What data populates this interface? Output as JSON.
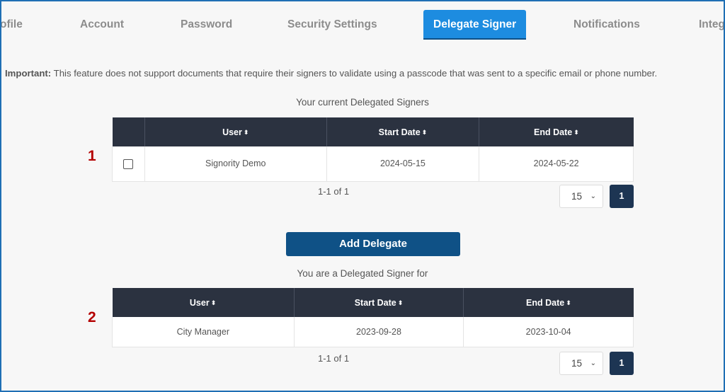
{
  "tabs": [
    {
      "label": "ofile"
    },
    {
      "label": "Account"
    },
    {
      "label": "Password"
    },
    {
      "label": "Security Settings"
    },
    {
      "label": "Delegate Signer"
    },
    {
      "label": "Notifications"
    },
    {
      "label": "Integ"
    }
  ],
  "notice": {
    "bold": "Important:",
    "text": "This feature does not support documents that require their signers to validate using a passcode that was sent to a specific email or phone number."
  },
  "current": {
    "caption": "Your current Delegated Signers",
    "marker": "1",
    "columns": [
      "User",
      "Start Date",
      "End Date"
    ],
    "rows": [
      {
        "user": "Signority Demo",
        "start": "2024-05-15",
        "end": "2024-05-22"
      }
    ],
    "range": "1-1 of 1",
    "page_size": "15",
    "page": "1"
  },
  "add_button": "Add Delegate",
  "delegated_for": {
    "caption": "You are a Delegated Signer for",
    "marker": "2",
    "columns": [
      "User",
      "Start Date",
      "End Date"
    ],
    "rows": [
      {
        "user": "City Manager",
        "start": "2023-09-28",
        "end": "2023-10-04"
      }
    ],
    "range": "1-1 of 1",
    "page_size": "15",
    "page": "1"
  },
  "icons": {
    "sort": "sort-icon",
    "dropdown": "chevron-down-icon"
  },
  "colors": {
    "active_tab": "#1d8ce0",
    "table_header": "#2b3240",
    "primary_button": "#0f5186",
    "page_button": "#1d3553",
    "marker": "#b40000"
  }
}
